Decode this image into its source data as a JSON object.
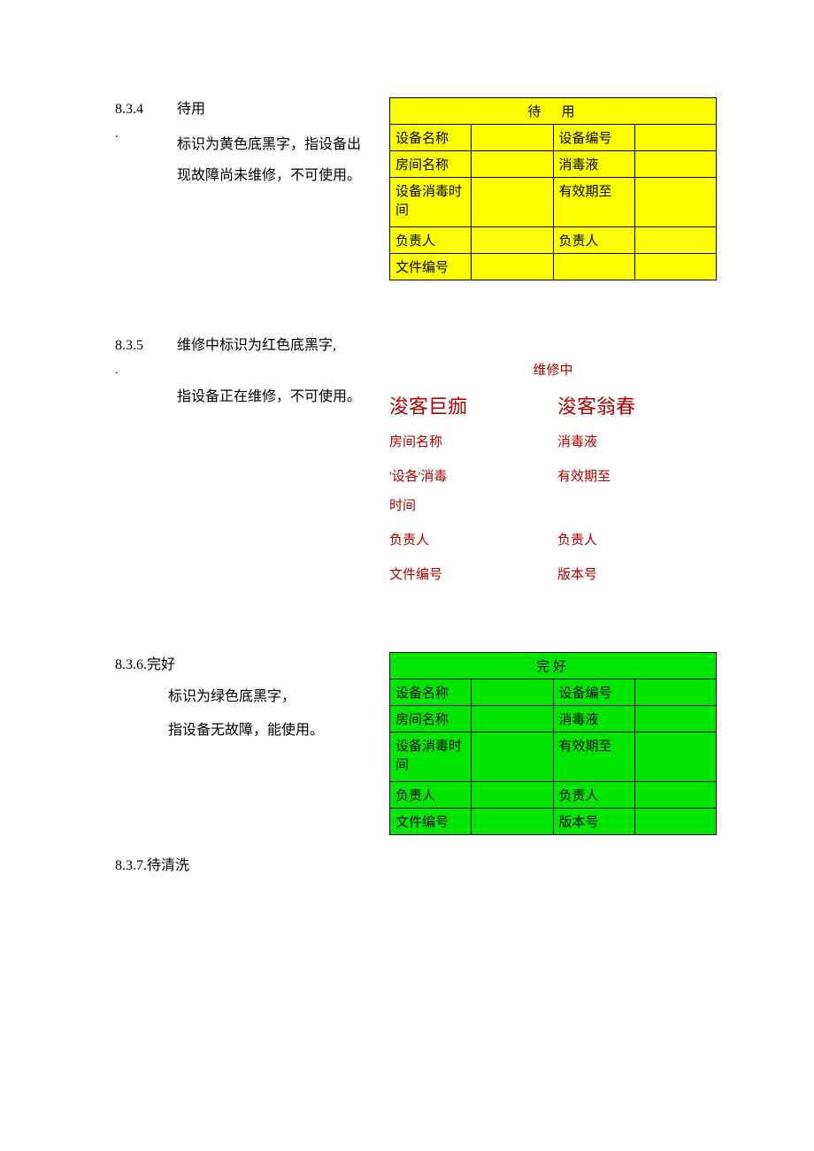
{
  "s834": {
    "num": "8.3.4",
    "dot": ".",
    "title": "待用",
    "desc1": "标识为黄色底黑字，指设备出",
    "desc2": "现故障尚未维修，不可使用。",
    "table": {
      "title": "待　用",
      "r1l": "设备名称",
      "r1r": "设备编号",
      "r2l": "房间名称",
      "r2r": "消毒液",
      "r3l": "设备消毒时间",
      "r3r": "有效期至",
      "r4l": "负责人",
      "r4r": "负责人",
      "r5l": "文件编号",
      "r5r": ""
    }
  },
  "s835": {
    "num": "8.3.5",
    "dot": ".",
    "line1": "维修中标识为红色底黑字,",
    "line2": "指设备正在维修，不可使用。",
    "block": {
      "title": "维修中",
      "b1l": "浚客巨痂",
      "b1r": "浚客翁春",
      "r2l": "房间名称",
      "r2r": "消毒液",
      "r3l": "'设各'消毒",
      "r3r": "有效期至",
      "r3l2": "时间",
      "r4l": "负责人",
      "r4r": "负责人",
      "r5l": "文件编号",
      "r5r": "版本号"
    }
  },
  "s836": {
    "num": "8.3.6.",
    "title": "完好",
    "desc1": "标识为绿色底黑字，",
    "desc2": "指设备无故障，能使用。",
    "table": {
      "title": "完好",
      "r1l": "设备名称",
      "r1r": "设备编号",
      "r2l": "房间名称",
      "r2r": "消毒液",
      "r3l": "设备消毒时间",
      "r3r": "有效期至",
      "r4l": "负责人",
      "r4r": "负责人",
      "r5l": "文件编号",
      "r5r": "版本号"
    }
  },
  "s837": {
    "num": "8.3.7.",
    "title": "待清洗"
  }
}
